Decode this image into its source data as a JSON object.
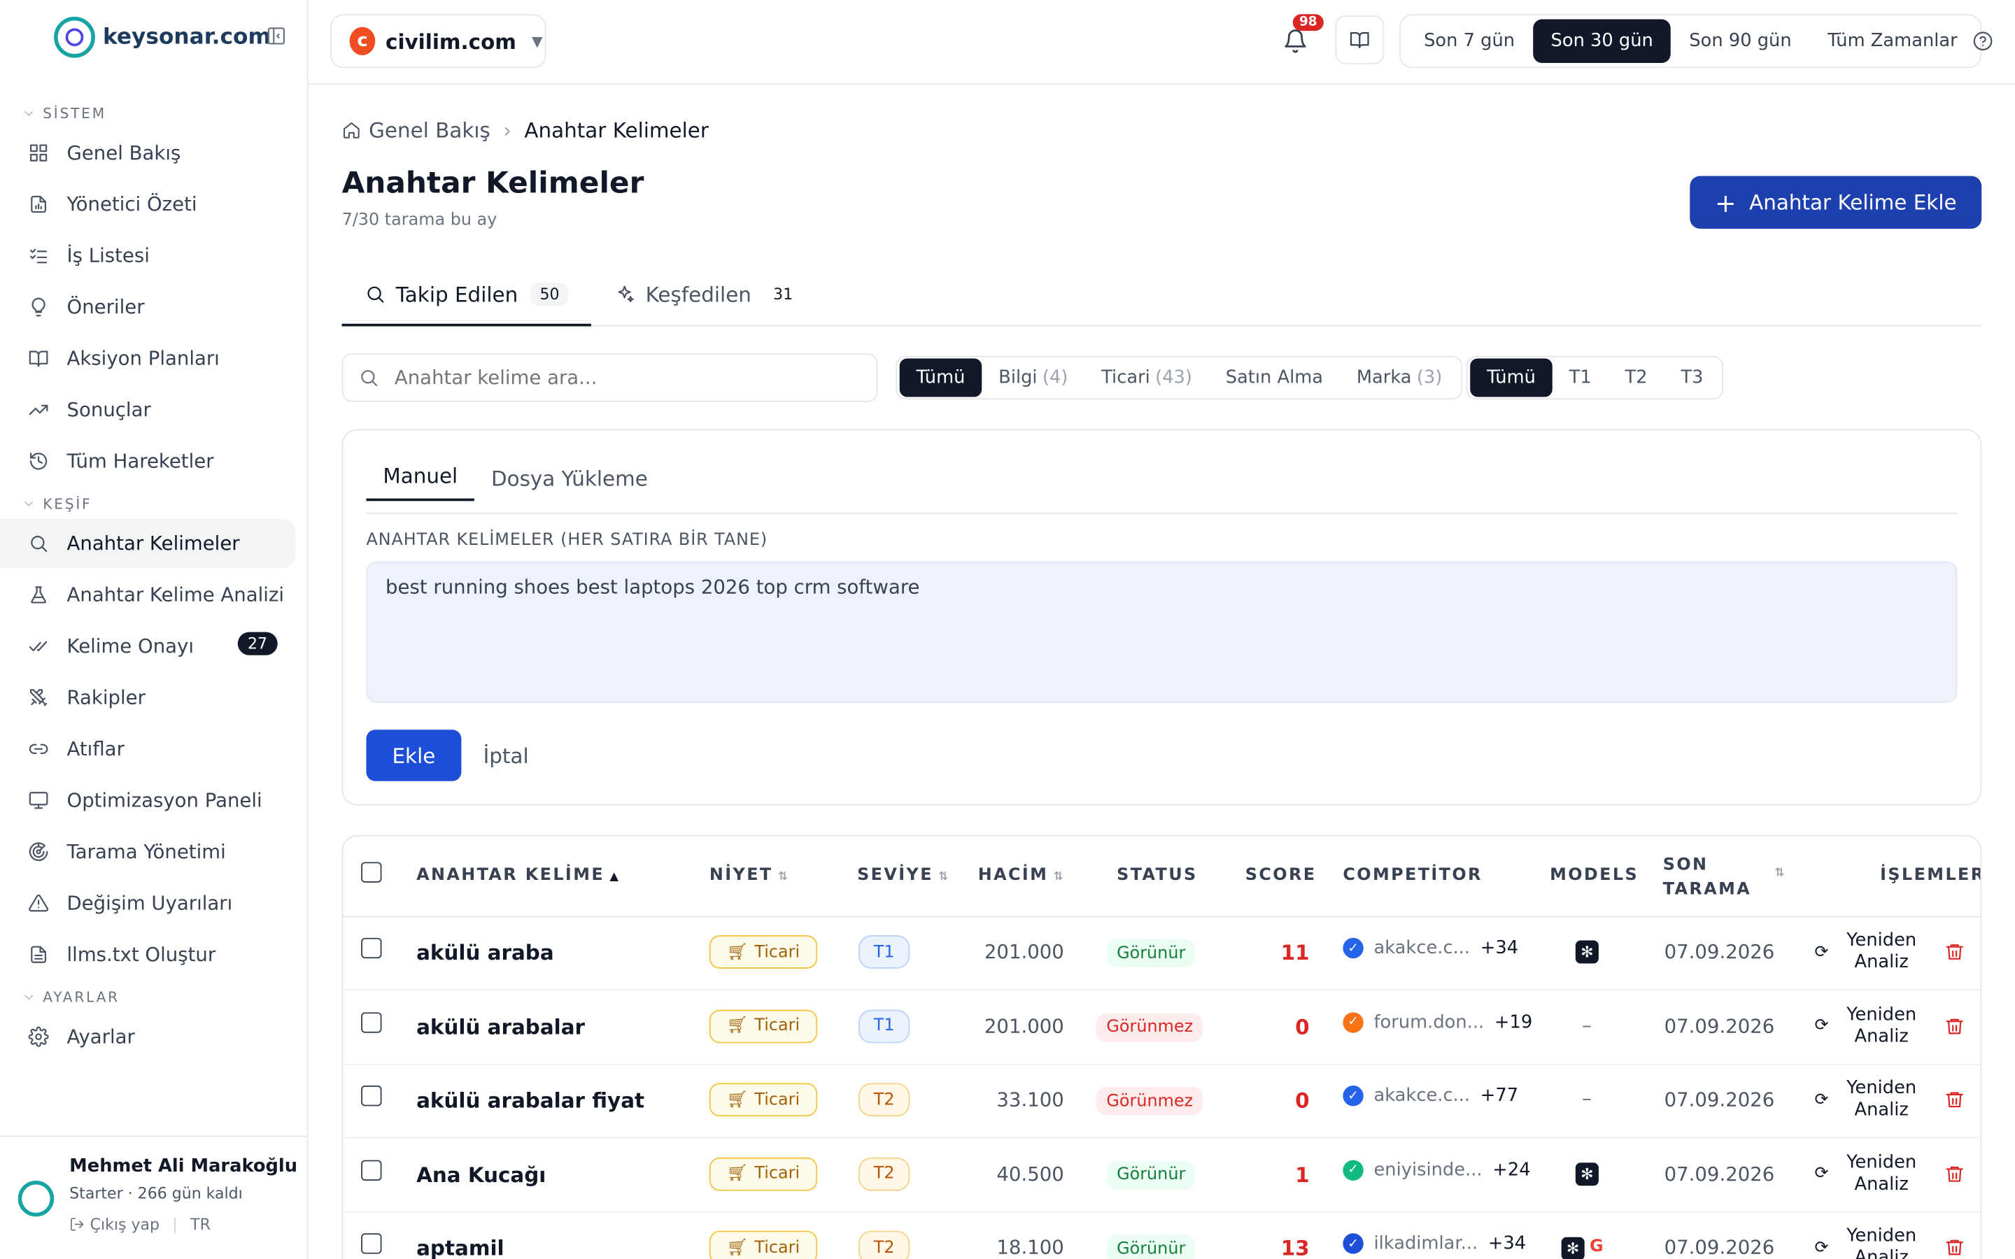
{
  "brand": {
    "name": "keysonar.com"
  },
  "sidebar": {
    "sections": [
      {
        "label": "SİSTEM",
        "items": [
          {
            "label": "Genel Bakış",
            "icon": "grid-icon"
          },
          {
            "label": "Yönetici Özeti",
            "icon": "file-chart-icon"
          },
          {
            "label": "İş Listesi",
            "icon": "list-check-icon"
          },
          {
            "label": "Öneriler",
            "icon": "lightbulb-icon"
          },
          {
            "label": "Aksiyon Planları",
            "icon": "book-open-icon"
          },
          {
            "label": "Sonuçlar",
            "icon": "trending-up-icon"
          },
          {
            "label": "Tüm Hareketler",
            "icon": "history-icon"
          }
        ]
      },
      {
        "label": "KEŞİF",
        "items": [
          {
            "label": "Anahtar Kelimeler",
            "icon": "search-icon",
            "active": true
          },
          {
            "label": "Anahtar Kelime Analizi",
            "icon": "flask-icon"
          },
          {
            "label": "Kelime Onayı",
            "icon": "check-double-icon",
            "badge": "27"
          },
          {
            "label": "Rakipler",
            "icon": "swords-icon"
          },
          {
            "label": "Atıflar",
            "icon": "link-icon"
          },
          {
            "label": "Optimizasyon Paneli",
            "icon": "monitor-icon"
          },
          {
            "label": "Tarama Yönetimi",
            "icon": "radar-icon"
          },
          {
            "label": "Değişim Uyarıları",
            "icon": "alert-triangle-icon"
          },
          {
            "label": "llms.txt Oluştur",
            "icon": "file-text-icon"
          }
        ]
      },
      {
        "label": "AYARLAR",
        "items": [
          {
            "label": "Ayarlar",
            "icon": "gear-icon"
          }
        ]
      }
    ]
  },
  "user": {
    "name": "Mehmet Ali Marakoğlu",
    "plan": "Starter · 266 gün kaldı",
    "logout": "Çıkış yap",
    "lang": "TR"
  },
  "topbar": {
    "site": "civilim.com",
    "notif_count": "98",
    "ranges": [
      "Son 7 gün",
      "Son 30 gün",
      "Son 90 gün",
      "Tüm Zamanlar"
    ],
    "active_range": 1
  },
  "breadcrumb": {
    "home": "Genel Bakış",
    "current": "Anahtar Kelimeler"
  },
  "page": {
    "title": "Anahtar Kelimeler",
    "subtitle": "7/30 tarama bu ay",
    "add_button": "Anahtar Kelime Ekle"
  },
  "tabs": [
    {
      "label": "Takip Edilen",
      "count": "50"
    },
    {
      "label": "Keşfedilen",
      "count": "31"
    }
  ],
  "filters": {
    "search_placeholder": "Anahtar kelime ara...",
    "intent": [
      {
        "label": "Tümü",
        "count": ""
      },
      {
        "label": "Bilgi",
        "count": "(4)"
      },
      {
        "label": "Ticari",
        "count": "(43)"
      },
      {
        "label": "Satın Alma",
        "count": ""
      },
      {
        "label": "Marka",
        "count": "(3)"
      }
    ],
    "level": [
      "Tümü",
      "T1",
      "T2",
      "T3"
    ]
  },
  "addform": {
    "tabs": [
      "Manuel",
      "Dosya Yükleme"
    ],
    "field_label": "ANAHTAR KELİMELER (HER SATIRA BİR TANE)",
    "textarea_value": "best running shoes best laptops 2026 top crm software",
    "submit": "Ekle",
    "cancel": "İptal"
  },
  "table": {
    "columns": {
      "keyword": "ANAHTAR KELİME",
      "intent": "NİYET",
      "level": "SEVİYE",
      "volume": "HACİM",
      "status": "STATUS",
      "score": "SCORE",
      "competitor": "COMPETİTOR",
      "models": "MODELS",
      "last_scan_1": "SON",
      "last_scan_2": "TARAMA",
      "actions": "İŞLEMLER"
    },
    "action_label_1": "Yeniden",
    "action_label_2": "Analiz",
    "rows": [
      {
        "keyword": "akülü araba",
        "intent": "Ticari",
        "level": "T1",
        "volume": "201.000",
        "status": "Görünür",
        "score": "11",
        "competitor": "akakce.c...",
        "comp_more": "+34",
        "models": "1",
        "last_scan": "07.09.2026"
      },
      {
        "keyword": "akülü arabalar",
        "intent": "Ticari",
        "level": "T1",
        "volume": "201.000",
        "status": "Görünmez",
        "score": "0",
        "competitor": "forum.don...",
        "comp_more": "+19",
        "models": "–",
        "last_scan": "07.09.2026"
      },
      {
        "keyword": "akülü arabalar fiyat",
        "intent": "Ticari",
        "level": "T2",
        "volume": "33.100",
        "status": "Görünmez",
        "score": "0",
        "competitor": "akakce.c...",
        "comp_more": "+77",
        "models": "–",
        "last_scan": "07.09.2026"
      },
      {
        "keyword": "Ana Kucağı",
        "intent": "Ticari",
        "level": "T2",
        "volume": "40.500",
        "status": "Görünür",
        "score": "1",
        "competitor": "eniyisinde...",
        "comp_more": "+24",
        "models": "1",
        "last_scan": "07.09.2026"
      },
      {
        "keyword": "aptamil",
        "intent": "Ticari",
        "level": "T2",
        "volume": "18.100",
        "status": "Görünür",
        "score": "13",
        "competitor": "ilkadimlar...",
        "comp_more": "+34",
        "models": "2",
        "last_scan": "07.09.2026"
      }
    ]
  }
}
